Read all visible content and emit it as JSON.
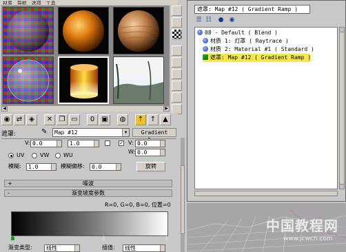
{
  "menubar": {
    "items": [
      "材质",
      "导航",
      "选项",
      "工具"
    ]
  },
  "slots": [
    {
      "name": "checker-sphere-slot",
      "active": false
    },
    {
      "name": "orange-sphere-slot",
      "active": false
    },
    {
      "name": "wood-sphere-slot",
      "active": false
    },
    {
      "name": "glass-checker-slot",
      "active": false
    },
    {
      "name": "lamp-cylinder-slot",
      "active": true
    },
    {
      "name": "landscape-slot",
      "active": false
    }
  ],
  "material": {
    "name_label": "遮罩:",
    "name_value": "Map #12",
    "type_button": "Gradient Ramp"
  },
  "coords": {
    "v_label": "V:",
    "v_value": "0.0",
    "w_label": "W:",
    "w_value": "0.0",
    "uv": "UV",
    "vw": "VW",
    "wu": "WU",
    "tile_value": "1.0",
    "blur_label": "模糊:",
    "blur_value": "1.0",
    "blur_offset_label": "模糊偏移:",
    "blur_offset_value": "0.0",
    "rotate_button": "旋转"
  },
  "rollouts": {
    "noise": {
      "sign": "+",
      "title": "噪波"
    },
    "gradient_params": {
      "sign": "-",
      "title": "渐变坡度参数"
    }
  },
  "gradient": {
    "readout": "R=0, G=0, B=0, 位置=0",
    "type_label": "渐变类型:",
    "type_value": "线性",
    "interp_label": "插值:",
    "interp_value": "线性",
    "flag_colors": [
      "#1a9a1a",
      "#d0d0d0",
      "#d0d0d0"
    ]
  },
  "navigator": {
    "title": "遮罩: Map #12  ( Gradient Ramp )",
    "tree": [
      {
        "label": "08 - Default  ( Blend )",
        "level": 0,
        "icon": "material-sphere-icon",
        "selected": false
      },
      {
        "label": "材质 1: 灯罩  ( Raytrace )",
        "level": 1,
        "icon": "material-sphere-icon",
        "selected": false
      },
      {
        "label": "材质 2: Material #1  ( Standard )",
        "level": 1,
        "icon": "material-sphere-icon",
        "selected": false
      },
      {
        "label": "遮罩: Map #12  ( Gradient Ramp )",
        "level": 1,
        "icon": "map-icon",
        "selected": true
      }
    ]
  },
  "watermark": {
    "cn": "中国教程网",
    "url": "www.jcwcn.com"
  }
}
